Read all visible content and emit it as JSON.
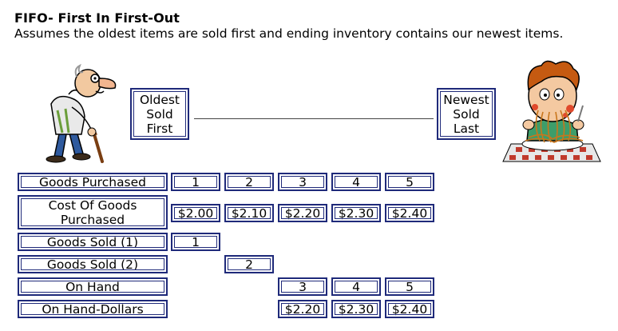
{
  "header": {
    "title": "FIFO- First In First-Out",
    "subtitle": "Assumes the oldest items are sold first and ending inventory contains our newest items."
  },
  "labels": {
    "oldest": "Oldest\nSold\nFirst",
    "newest": "Newest\nSold\nLast"
  },
  "illustrations": {
    "left": "old-man-with-cane-icon",
    "right": "boy-eating-spaghetti-icon"
  },
  "table": {
    "rows": [
      {
        "label": "Goods Purchased",
        "cells": [
          "1",
          "2",
          "3",
          "4",
          "5"
        ]
      },
      {
        "label": "Cost Of Goods\nPurchased",
        "cells": [
          "$2.00",
          "$2.10",
          "$2.20",
          "$2.30",
          "$2.40"
        ]
      },
      {
        "label": "Goods Sold (1)",
        "cells": [
          "1",
          "",
          "",
          "",
          ""
        ]
      },
      {
        "label": "Goods Sold (2)",
        "cells": [
          "",
          "2",
          "",
          "",
          ""
        ]
      },
      {
        "label": "On Hand",
        "cells": [
          "",
          "",
          "3",
          "4",
          "5"
        ]
      },
      {
        "label": "On Hand-Dollars",
        "cells": [
          "",
          "",
          "$2.20",
          "$2.30",
          "$2.40"
        ]
      }
    ]
  }
}
